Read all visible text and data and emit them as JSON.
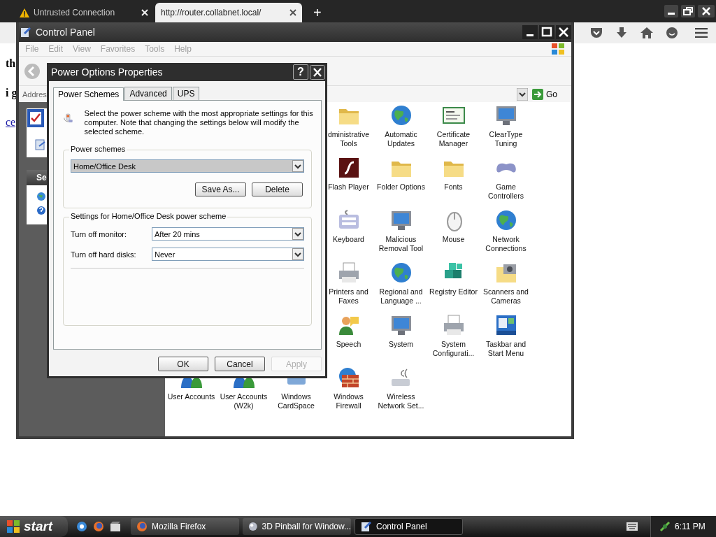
{
  "browser": {
    "tabs": [
      {
        "label": "Untrusted Connection",
        "selected": false,
        "warning": true
      },
      {
        "label": "http://router.collabnet.local/",
        "selected": true,
        "warning": false
      }
    ],
    "new_tab": "+"
  },
  "page": {
    "texts": [
      {
        "text": "th",
        "kind": "bold"
      },
      {
        "text": "i g",
        "kind": "bold"
      },
      {
        "text": "ce",
        "kind": "link"
      }
    ]
  },
  "control_panel": {
    "title": "Control Panel",
    "menu": [
      "File",
      "Edit",
      "View",
      "Favorites",
      "Tools",
      "Help"
    ],
    "address_label": "Addres",
    "go": "Go",
    "side_header": "Se",
    "rows": [
      [
        "",
        "",
        "",
        "dministrative Tools",
        "Automatic Updates",
        "Certificate Manager",
        "ClearType Tuning"
      ],
      [
        "",
        "",
        "",
        "Flash Player",
        "Folder Options",
        "Fonts",
        "Game Controllers"
      ],
      [
        "",
        "",
        "",
        "Keyboard",
        "Malicious Removal Tool",
        "Mouse",
        "Network Connections"
      ],
      [
        "",
        "",
        "",
        "Printers and Faxes",
        "Regional and Language ...",
        "Registry Editor",
        "Scanners and Cameras"
      ],
      [
        "",
        "",
        "",
        "Speech",
        "System",
        "System Configurati...",
        "Taskbar and Start Menu"
      ],
      [
        "User Accounts",
        "User Accounts (W2k)",
        "Windows CardSpace",
        "Windows Firewall",
        "Wireless Network Set..."
      ]
    ]
  },
  "dialog": {
    "title": "Power Options Properties",
    "help": "?",
    "tabs": [
      {
        "label": "Power Schemes",
        "selected": true
      },
      {
        "label": "Advanced",
        "selected": false
      },
      {
        "label": "UPS",
        "selected": false
      }
    ],
    "description": "Select the power scheme with the most appropriate settings for this computer. Note that changing the settings below will modify the selected scheme.",
    "scheme_group": "Power schemes",
    "scheme": "Home/Office Desk",
    "scheme_buttons": [
      "Save As...",
      "Delete"
    ],
    "settings_group": "Settings for Home/Office Desk power scheme",
    "settings": [
      {
        "label": "Turn off monitor:",
        "value": "After 20 mins"
      },
      {
        "label": "Turn off hard disks:",
        "value": "Never"
      }
    ],
    "buttons": [
      {
        "label": "OK",
        "disabled": false
      },
      {
        "label": "Cancel",
        "disabled": false
      },
      {
        "label": "Apply",
        "disabled": true
      }
    ]
  },
  "taskbar": {
    "start": "start",
    "tasks": [
      {
        "label": "Mozilla Firefox",
        "selected": false
      },
      {
        "label": "3D Pinball for Window...",
        "selected": false
      },
      {
        "label": "Control Panel",
        "selected": true
      }
    ],
    "clock": "6:11 PM"
  }
}
